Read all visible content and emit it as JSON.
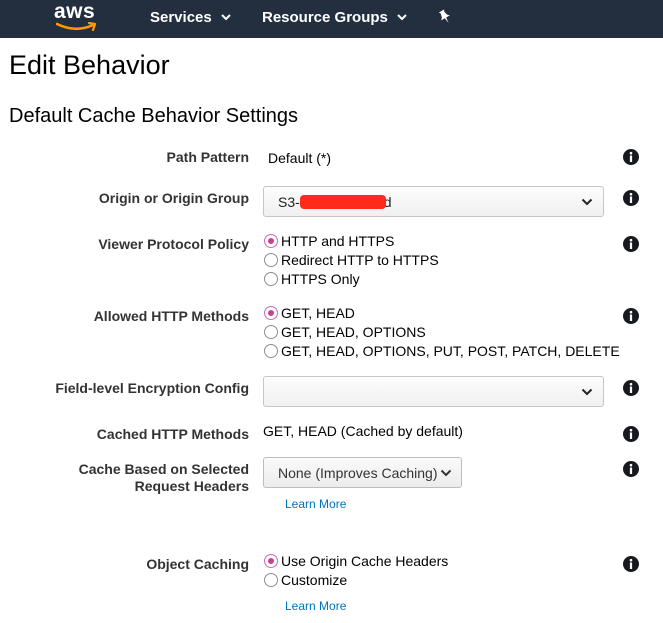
{
  "nav": {
    "logo": "aws",
    "services": "Services",
    "resource_groups": "Resource Groups"
  },
  "page": {
    "title": "Edit Behavior",
    "section": "Default Cache Behavior Settings"
  },
  "fields": {
    "path_pattern": {
      "label": "Path Pattern",
      "value": "Default (*)"
    },
    "origin": {
      "label": "Origin or Origin Group",
      "value_prefix": "S3-",
      "value_suffix": "d"
    },
    "viewer_protocol": {
      "label": "Viewer Protocol Policy",
      "options": [
        "HTTP and HTTPS",
        "Redirect HTTP to HTTPS",
        "HTTPS Only"
      ],
      "selected": 0
    },
    "allowed_methods": {
      "label": "Allowed HTTP Methods",
      "options": [
        "GET, HEAD",
        "GET, HEAD, OPTIONS",
        "GET, HEAD, OPTIONS, PUT, POST, PATCH, DELETE"
      ],
      "selected": 0
    },
    "fle_config": {
      "label": "Field-level Encryption Config",
      "value": ""
    },
    "cached_methods": {
      "label": "Cached HTTP Methods",
      "value": "GET, HEAD (Cached by default)"
    },
    "cache_headers": {
      "label_line1": "Cache Based on Selected",
      "label_line2": "Request Headers",
      "value": "None (Improves Caching)",
      "learn_more": "Learn More"
    },
    "object_caching": {
      "label": "Object Caching",
      "options": [
        "Use Origin Cache Headers",
        "Customize"
      ],
      "selected": 0,
      "learn_more": "Learn More"
    }
  },
  "colors": {
    "nav_bg": "#232f3e",
    "link": "#0073bb",
    "radio_selected": "#c2478f",
    "redaction": "#ff2a1a"
  }
}
